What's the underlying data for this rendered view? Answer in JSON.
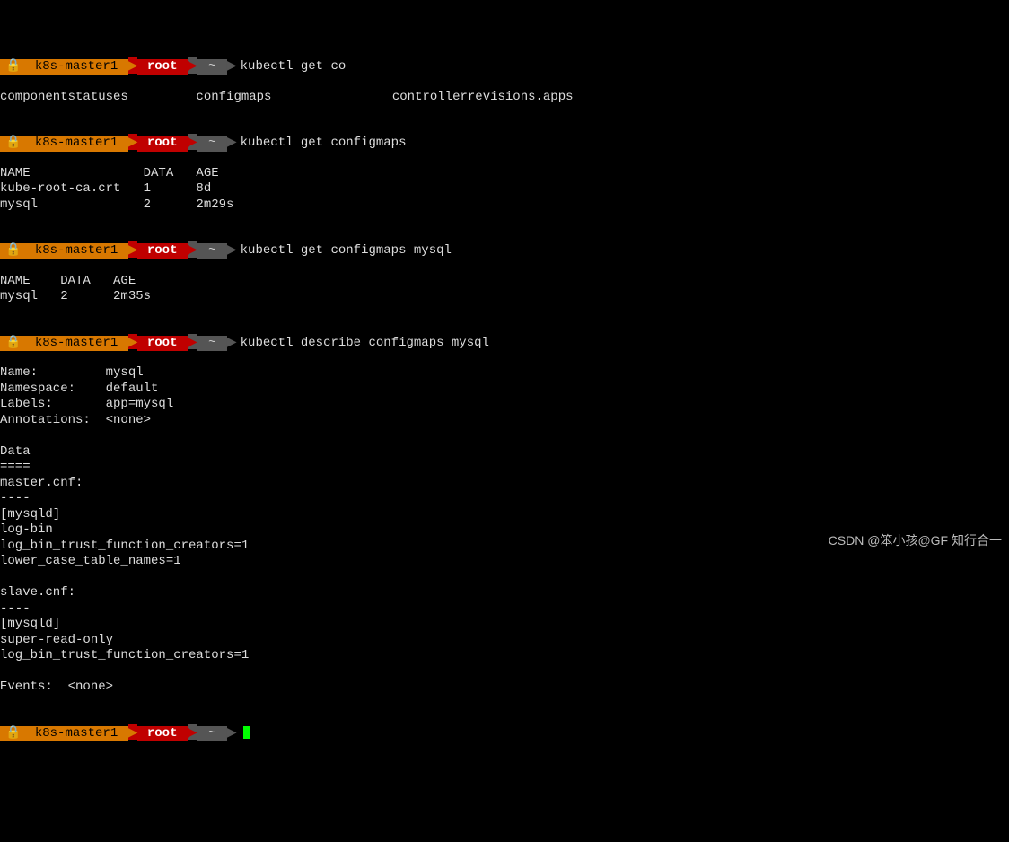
{
  "prompt": {
    "lock": "🔒",
    "host": "k8s-master1",
    "user": "root",
    "path": "~",
    "arrow": "▶"
  },
  "block1": {
    "command": "kubectl get co",
    "output": "componentstatuses         configmaps                controllerrevisions.apps"
  },
  "block2": {
    "command": "kubectl get configmaps",
    "output": "NAME               DATA   AGE\nkube-root-ca.crt   1      8d\nmysql              2      2m29s"
  },
  "block3": {
    "command": "kubectl get configmaps mysql",
    "output": "NAME    DATA   AGE\nmysql   2      2m35s"
  },
  "block4": {
    "command": "kubectl describe configmaps mysql",
    "output": "Name:         mysql\nNamespace:    default\nLabels:       app=mysql\nAnnotations:  <none>\n\nData\n====\nmaster.cnf:\n----\n[mysqld]\nlog-bin\nlog_bin_trust_function_creators=1\nlower_case_table_names=1\n\nslave.cnf:\n----\n[mysqld]\nsuper-read-only\nlog_bin_trust_function_creators=1\n\nEvents:  <none>"
  },
  "block5": {
    "command": ""
  },
  "watermark": "CSDN @笨小孩@GF 知行合一"
}
